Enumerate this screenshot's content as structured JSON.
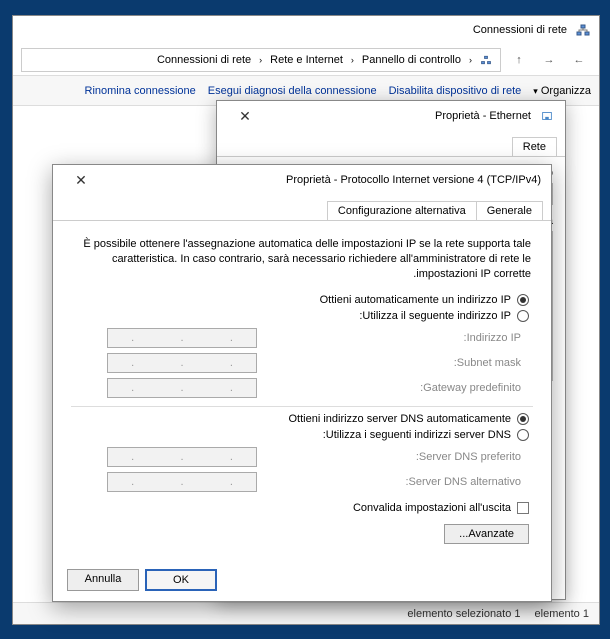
{
  "window": {
    "title": "Connessioni di rete"
  },
  "nav": {
    "back": "←",
    "fwd": "→",
    "up": "↑"
  },
  "breadcrumb": {
    "root": "Pannello di controllo",
    "mid": "Rete e Internet",
    "leaf": "Connessioni di rete",
    "sep": "›"
  },
  "cmdbar": {
    "organize": "Organizza",
    "disable": "Disabilita dispositivo di rete",
    "diagnose": "Esegui diagnosi della connessione",
    "rename": "Rinomina connessione"
  },
  "dialog_ethernet": {
    "title": "Proprietà - Ethernet",
    "tab_net": "Rete",
    "conn_label": "Co",
    "list_label": "La"
  },
  "dialog_ipv4": {
    "title": "Proprietà - Protocollo Internet versione 4 (TCP/IPv4)",
    "tab_general": "Generale",
    "tab_alt": "Configurazione alternativa",
    "description": "È possibile ottenere l'assegnazione automatica delle impostazioni IP se la rete supporta tale caratteristica. In caso contrario, sarà necessario richiedere all'amministratore di rete le impostazioni IP corrette.",
    "ip_auto": "Ottieni automaticamente un indirizzo IP",
    "ip_manual": "Utilizza il seguente indirizzo IP:",
    "ip_addr_label": "Indirizzo IP:",
    "subnet_label": "Subnet mask:",
    "gateway_label": "Gateway predefinito:",
    "dns_auto": "Ottieni indirizzo server DNS automaticamente",
    "dns_manual": "Utilizza i seguenti indirizzi server DNS:",
    "dns_pref_label": "Server DNS preferito:",
    "dns_alt_label": "Server DNS alternativo:",
    "validate": "Convalida impostazioni all'uscita",
    "advanced": "Avanzate...",
    "ok": "OK",
    "cancel": "Annulla",
    "close_x": "✕"
  },
  "statusbar": {
    "count": "1 elemento",
    "selected": "1 elemento selezionato"
  }
}
